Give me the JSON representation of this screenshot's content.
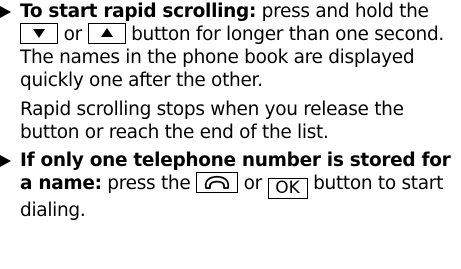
{
  "item1": {
    "lead": "To start rapid scrolling:",
    "text_a": " press and hold the ",
    "text_or": " or ",
    "text_b": " button for longer than one second.",
    "key_down_icon": "down-arrow-key",
    "key_up_icon": "up-arrow-key"
  },
  "para1": "The names in the phone book are displayed quickly one after the other.",
  "para2": "Rapid scrolling stops when you release the button or reach the end of the list.",
  "item2": {
    "lead": "If only one telephone number is stored for a name:",
    "text_a": " press the ",
    "text_or": " or ",
    "ok_label": "OK",
    "text_b": " button to start dialing.",
    "phone_icon": "phone-handset-icon"
  }
}
